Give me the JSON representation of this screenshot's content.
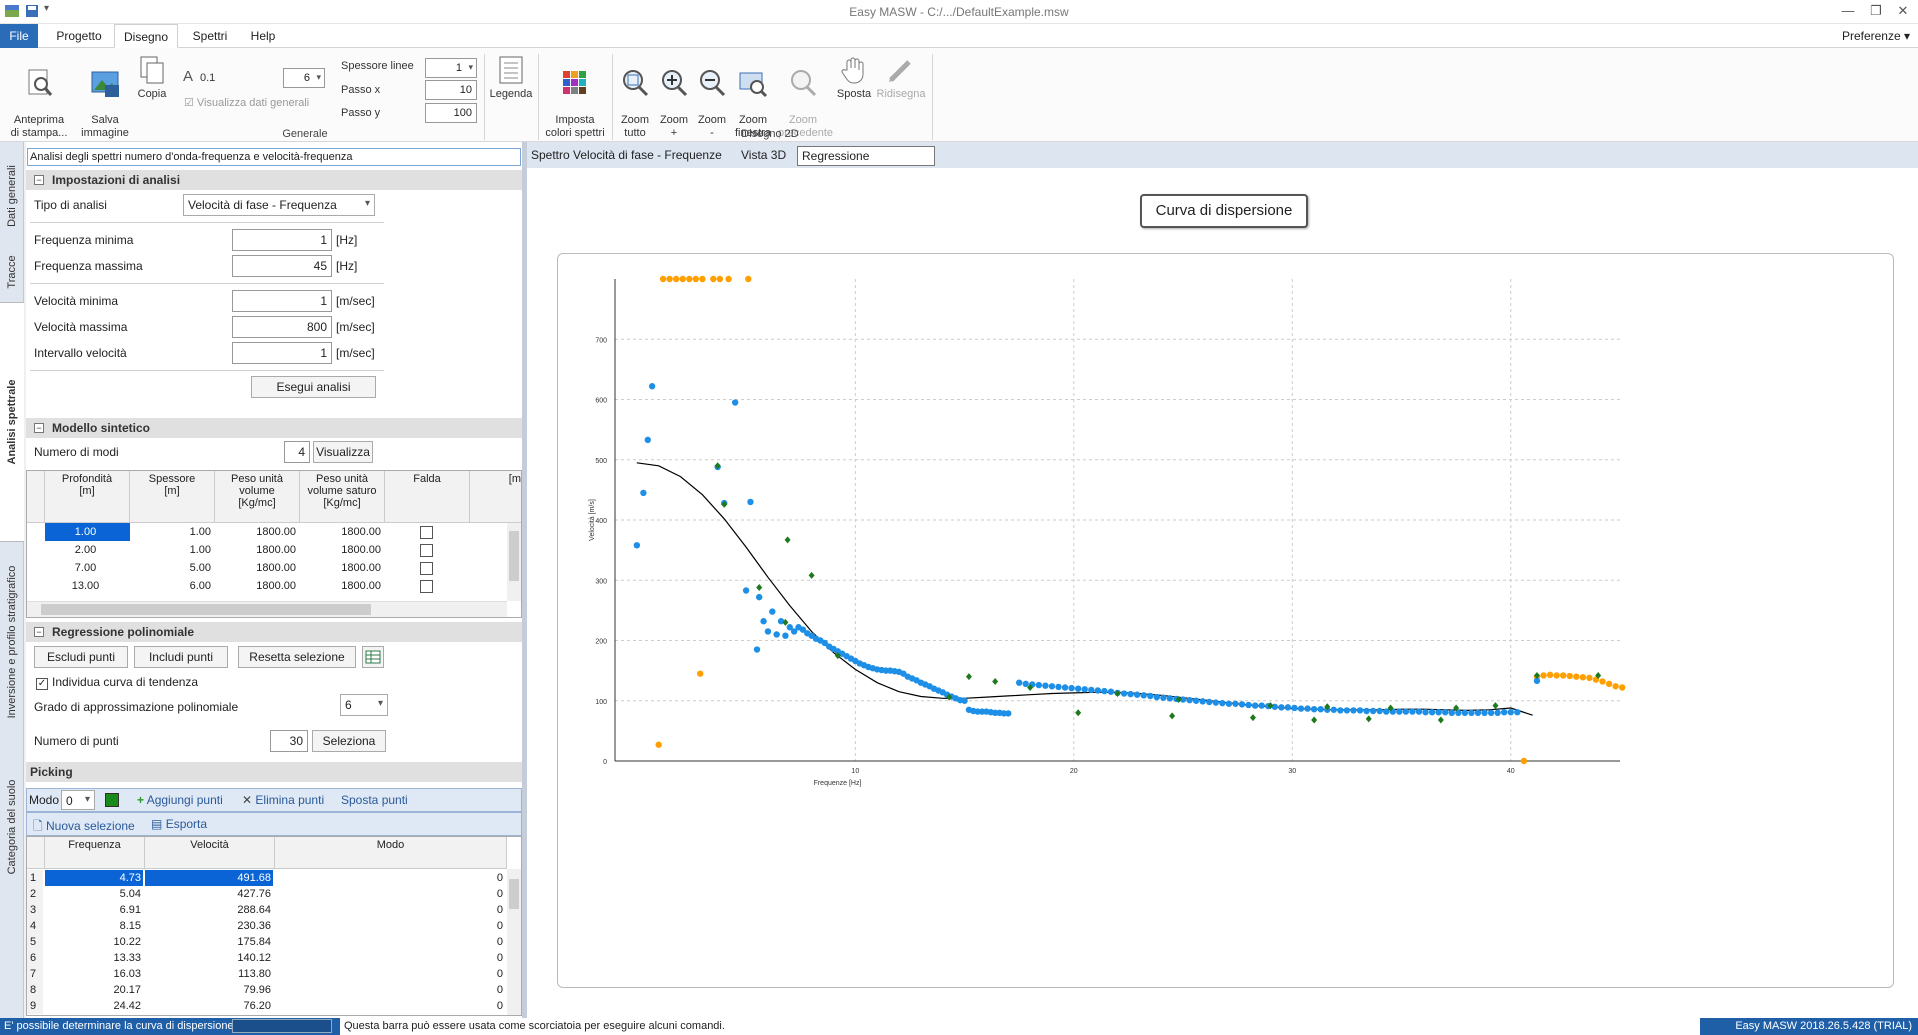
{
  "app": {
    "title": "Easy MASW - C:/.../DefaultExample.msw",
    "preferences": "Preferenze",
    "menu_tabs": [
      "File",
      "Progetto",
      "Disegno",
      "Spettri",
      "Help"
    ],
    "active_menu": "Disegno"
  },
  "ribbon": {
    "anteprima": "Anteprima\ndi stampa...",
    "salva": "Salva\nimmagine",
    "copia": "Copia",
    "font_label": "A",
    "font_size": "0.1",
    "size_value": "6",
    "visualizza": "Visualizza dati generali",
    "spessore_linee": "Spessore linee",
    "spessore_value": "1",
    "passo_x": "Passo x",
    "passo_x_value": "10",
    "passo_y": "Passo y",
    "passo_y_value": "100",
    "legenda": "Legenda",
    "imposta_colori": "Imposta\ncolori spettri",
    "group_generale": "Generale",
    "zoom_tutto": "Zoom\ntutto",
    "zoom_plus": "Zoom\n+",
    "zoom_minus": "Zoom\n-",
    "zoom_finestra": "Zoom\nfinestra",
    "zoom_precedente": "Zoom\nprecedente",
    "sposta": "Sposta",
    "ridisegna": "Ridisegna",
    "group_disegno": "Disegno 2D"
  },
  "vtabs": [
    "Dati generali",
    "Tracce",
    "Analisi spettrale",
    "Inversione e profilo stratigrafico",
    "Categoria del suolo"
  ],
  "left": {
    "description": "Analisi degli spettri numero d'onda-frequenza e velocità-frequenza",
    "sec_impostazioni": "Impostazioni di analisi",
    "tipo_analisi_label": "Tipo di analisi",
    "tipo_analisi_value": "Velocità di fase - Frequenza",
    "freq_min_label": "Frequenza minima",
    "freq_min": "1",
    "freq_max_label": "Frequenza massima",
    "freq_max": "45",
    "unit_hz": "[Hz]",
    "vel_min_label": "Velocità minima",
    "vel_min": "1",
    "vel_max_label": "Velocità massima",
    "vel_max": "800",
    "int_vel_label": "Intervallo velocità",
    "int_vel": "1",
    "unit_ms": "[m/sec]",
    "esegui": "Esegui analisi",
    "sec_modello": "Modello sintetico",
    "num_modi_label": "Numero di modi",
    "num_modi": "4",
    "visualizza_btn": "Visualizza",
    "model_headers": [
      "Profondità\n[m]",
      "Spessore\n[m]",
      "Peso unità\nvolume\n[Kg/mc]",
      "Peso unità\nvolume saturo\n[Kg/mc]",
      "Falda",
      "[m"
    ],
    "model_rows": [
      [
        "1.00",
        "1.00",
        "1800.00",
        "1800.00"
      ],
      [
        "2.00",
        "1.00",
        "1800.00",
        "1800.00"
      ],
      [
        "7.00",
        "5.00",
        "1800.00",
        "1800.00"
      ],
      [
        "13.00",
        "6.00",
        "1800.00",
        "1800.00"
      ]
    ],
    "sec_regressione": "Regressione polinomiale",
    "escludi": "Escludi punti",
    "includi": "Includi punti",
    "resetta": "Resetta selezione",
    "individua": "Individua curva di tendenza",
    "grado_label": "Grado di approssimazione polinomiale",
    "grado": "6",
    "num_punti_label": "Numero di punti",
    "num_punti": "30",
    "seleziona": "Seleziona",
    "sec_picking": "Picking",
    "modo_label": "Modo",
    "modo_value": "0",
    "aggiungi": "Aggiungi punti",
    "elimina": "Elimina punti",
    "sposta_punti": "Sposta punti",
    "nuova_sel": "Nuova selezione",
    "esporta": "Esporta",
    "pick_headers": [
      "Frequenza",
      "Velocità",
      "Modo"
    ],
    "pick_rows": [
      [
        "1",
        "4.73",
        "491.68",
        "0"
      ],
      [
        "2",
        "5.04",
        "427.76",
        "0"
      ],
      [
        "3",
        "6.91",
        "288.64",
        "0"
      ],
      [
        "4",
        "8.15",
        "230.36",
        "0"
      ],
      [
        "5",
        "10.22",
        "175.84",
        "0"
      ],
      [
        "6",
        "13.33",
        "140.12",
        "0"
      ],
      [
        "7",
        "16.03",
        "113.80",
        "0"
      ],
      [
        "8",
        "20.17",
        "79.96",
        "0"
      ],
      [
        "9",
        "24.42",
        "76.20",
        "0"
      ]
    ]
  },
  "right": {
    "tabs": [
      "Spettro Velocità di fase - Frequenze",
      "Vista 3D",
      "Regressione polinomiale"
    ],
    "active_tab": "Regressione polinomiale",
    "chart_title": "Curva di dispersione"
  },
  "chart_data": {
    "type": "scatter",
    "title": "Curva di dispersione",
    "xlabel": "Frequenze [Hz]",
    "ylabel": "Velocità [m/s]",
    "xlim": [
      0,
      45
    ],
    "ylim": [
      0,
      800
    ],
    "xticks": [
      10,
      20,
      30,
      40
    ],
    "yticks": [
      0,
      100,
      200,
      300,
      400,
      500,
      600,
      700
    ],
    "grid": true,
    "colors": {
      "blue": "#1e8fe6",
      "green": "#1f7a1f",
      "orange": "#ff9f00",
      "line": "#000000"
    },
    "series": [
      {
        "color_key": "orange",
        "marker": "circle",
        "points": [
          [
            1.2,
            800
          ],
          [
            1.5,
            800
          ],
          [
            1.8,
            800
          ],
          [
            2.1,
            800
          ],
          [
            2.4,
            800
          ],
          [
            2.7,
            800
          ],
          [
            3.0,
            800
          ],
          [
            3.5,
            800
          ],
          [
            3.8,
            800
          ],
          [
            4.2,
            800
          ],
          [
            5.1,
            800
          ],
          [
            2.9,
            145
          ],
          [
            1.0,
            27
          ],
          [
            40.6,
            0
          ],
          [
            41.2,
            140
          ],
          [
            41.5,
            142
          ],
          [
            41.8,
            143
          ],
          [
            42.1,
            142
          ],
          [
            42.4,
            142
          ],
          [
            42.7,
            141
          ],
          [
            43.0,
            140
          ],
          [
            43.3,
            139
          ],
          [
            43.6,
            138
          ],
          [
            43.9,
            135
          ],
          [
            44.2,
            132
          ],
          [
            44.5,
            128
          ],
          [
            44.8,
            124
          ],
          [
            45.1,
            122
          ]
        ]
      },
      {
        "color_key": "blue",
        "marker": "circle",
        "points": [
          [
            0,
            358
          ],
          [
            0.3,
            445
          ],
          [
            0.5,
            533
          ],
          [
            0.7,
            622
          ],
          [
            3.7,
            488
          ],
          [
            4.0,
            428
          ],
          [
            4.5,
            595
          ],
          [
            5.0,
            283
          ],
          [
            5.2,
            430
          ],
          [
            5.5,
            185
          ],
          [
            5.6,
            272
          ],
          [
            5.8,
            232
          ],
          [
            6.0,
            215
          ],
          [
            6.2,
            248
          ],
          [
            6.4,
            210
          ],
          [
            6.6,
            232
          ],
          [
            6.8,
            208
          ],
          [
            7.0,
            222
          ],
          [
            7.2,
            215
          ],
          [
            7.4,
            222
          ],
          [
            7.6,
            218
          ],
          [
            7.8,
            212
          ],
          [
            8.0,
            208
          ],
          [
            8.2,
            203
          ],
          [
            8.4,
            200
          ],
          [
            8.6,
            196
          ],
          [
            8.8,
            190
          ],
          [
            9.0,
            186
          ],
          [
            9.2,
            182
          ],
          [
            9.4,
            178
          ],
          [
            9.6,
            174
          ],
          [
            9.8,
            170
          ],
          [
            10.0,
            166
          ],
          [
            10.2,
            162
          ],
          [
            10.4,
            159
          ],
          [
            10.6,
            156
          ],
          [
            10.8,
            154
          ],
          [
            11.0,
            152
          ],
          [
            11.2,
            151
          ],
          [
            11.4,
            150
          ],
          [
            11.6,
            150
          ],
          [
            11.8,
            149
          ],
          [
            12.0,
            148
          ],
          [
            12.2,
            145
          ],
          [
            12.4,
            140
          ],
          [
            12.6,
            137
          ],
          [
            12.8,
            134
          ],
          [
            13.0,
            130
          ],
          [
            13.2,
            127
          ],
          [
            13.4,
            124
          ],
          [
            13.6,
            120
          ],
          [
            13.8,
            117
          ],
          [
            14.0,
            114
          ],
          [
            14.2,
            110
          ],
          [
            14.4,
            107
          ],
          [
            14.6,
            104
          ],
          [
            14.8,
            101
          ],
          [
            15.0,
            100
          ],
          [
            15.2,
            85
          ],
          [
            15.4,
            83
          ],
          [
            15.6,
            82
          ],
          [
            15.8,
            82
          ],
          [
            16.0,
            82
          ],
          [
            16.2,
            81
          ],
          [
            16.4,
            80
          ],
          [
            16.6,
            80
          ],
          [
            16.8,
            79
          ],
          [
            17.0,
            79
          ],
          [
            17.5,
            130
          ],
          [
            17.8,
            128
          ],
          [
            18.1,
            127
          ],
          [
            18.4,
            126
          ],
          [
            18.7,
            125
          ],
          [
            19.0,
            124
          ],
          [
            19.3,
            123
          ],
          [
            19.6,
            122
          ],
          [
            19.9,
            121
          ],
          [
            20.2,
            120
          ],
          [
            20.5,
            119
          ],
          [
            20.8,
            118
          ],
          [
            21.1,
            117
          ],
          [
            21.4,
            116
          ],
          [
            21.7,
            115
          ],
          [
            22.0,
            113
          ],
          [
            22.3,
            112
          ],
          [
            22.6,
            111
          ],
          [
            22.9,
            110
          ],
          [
            23.2,
            109
          ],
          [
            23.5,
            108
          ],
          [
            23.8,
            106
          ],
          [
            24.1,
            105
          ],
          [
            24.4,
            104
          ],
          [
            24.7,
            103
          ],
          [
            25.0,
            102
          ],
          [
            25.3,
            101
          ],
          [
            25.6,
            100
          ],
          [
            25.9,
            99
          ],
          [
            26.2,
            98
          ],
          [
            26.5,
            97
          ],
          [
            26.8,
            96
          ],
          [
            27.1,
            95
          ],
          [
            27.4,
            95
          ],
          [
            27.7,
            94
          ],
          [
            28.0,
            93
          ],
          [
            28.3,
            92
          ],
          [
            28.6,
            92
          ],
          [
            28.9,
            91
          ],
          [
            29.2,
            90
          ],
          [
            29.5,
            89
          ],
          [
            29.8,
            89
          ],
          [
            30.1,
            88
          ],
          [
            30.4,
            87
          ],
          [
            30.7,
            87
          ],
          [
            31.0,
            86
          ],
          [
            31.3,
            86
          ],
          [
            31.6,
            85
          ],
          [
            31.9,
            85
          ],
          [
            32.2,
            84
          ],
          [
            32.5,
            84
          ],
          [
            32.8,
            84
          ],
          [
            33.1,
            84
          ],
          [
            33.4,
            83
          ],
          [
            33.7,
            83
          ],
          [
            34.0,
            83
          ],
          [
            34.3,
            82
          ],
          [
            34.6,
            82
          ],
          [
            34.9,
            82
          ],
          [
            35.2,
            82
          ],
          [
            35.5,
            82
          ],
          [
            35.8,
            82
          ],
          [
            36.1,
            81
          ],
          [
            36.4,
            81
          ],
          [
            36.7,
            81
          ],
          [
            37.0,
            81
          ],
          [
            37.3,
            80
          ],
          [
            37.6,
            80
          ],
          [
            37.9,
            80
          ],
          [
            38.2,
            80
          ],
          [
            38.5,
            80
          ],
          [
            38.8,
            80
          ],
          [
            39.1,
            80
          ],
          [
            39.4,
            80
          ],
          [
            39.7,
            81
          ],
          [
            40.0,
            81
          ],
          [
            40.3,
            81
          ],
          [
            41.2,
            133
          ]
        ]
      },
      {
        "color_key": "green",
        "marker": "diamond",
        "points": [
          [
            3.7,
            490
          ],
          [
            4.0,
            426
          ],
          [
            5.6,
            288
          ],
          [
            6.8,
            230
          ],
          [
            6.9,
            367
          ],
          [
            8.0,
            308
          ],
          [
            9.2,
            175
          ],
          [
            14.3,
            106
          ],
          [
            15.2,
            140
          ],
          [
            16.4,
            132
          ],
          [
            18.0,
            122
          ],
          [
            20.2,
            80
          ],
          [
            22.0,
            112
          ],
          [
            24.5,
            75
          ],
          [
            24.8,
            102
          ],
          [
            28.2,
            72
          ],
          [
            29.0,
            92
          ],
          [
            31.0,
            68
          ],
          [
            31.6,
            90
          ],
          [
            33.5,
            70
          ],
          [
            34.5,
            88
          ],
          [
            36.8,
            68
          ],
          [
            37.5,
            88
          ],
          [
            39.3,
            92
          ],
          [
            41.2,
            142
          ],
          [
            44.0,
            142
          ]
        ]
      }
    ],
    "trend_line": {
      "color_key": "line",
      "points": [
        [
          0,
          495
        ],
        [
          1,
          490
        ],
        [
          2,
          472
        ],
        [
          3,
          442
        ],
        [
          4,
          402
        ],
        [
          5,
          355
        ],
        [
          6,
          305
        ],
        [
          7,
          258
        ],
        [
          8,
          215
        ],
        [
          9,
          180
        ],
        [
          10,
          152
        ],
        [
          11,
          130
        ],
        [
          12,
          115
        ],
        [
          13,
          107
        ],
        [
          14,
          104
        ],
        [
          15,
          104
        ],
        [
          16,
          106
        ],
        [
          17,
          108
        ],
        [
          18,
          110
        ],
        [
          19,
          112
        ],
        [
          20,
          113
        ],
        [
          21,
          114
        ],
        [
          22,
          114
        ],
        [
          23,
          112
        ],
        [
          24,
          109
        ],
        [
          25,
          105
        ],
        [
          26,
          101
        ],
        [
          27,
          97
        ],
        [
          28,
          93
        ],
        [
          29,
          90
        ],
        [
          30,
          87
        ],
        [
          31,
          86
        ],
        [
          32,
          85
        ],
        [
          33,
          85
        ],
        [
          34,
          85
        ],
        [
          35,
          86
        ],
        [
          36,
          86
        ],
        [
          37,
          85
        ],
        [
          38,
          84
        ],
        [
          39,
          85
        ],
        [
          40,
          88
        ],
        [
          41,
          76
        ]
      ]
    }
  },
  "status": {
    "left": "E' possibile determinare la curva di dispersione.",
    "hint": "Questa barra può essere usata come scorciatoia per eseguire alcuni comandi.",
    "version": "Easy MASW 2018.26.5.428 (TRIAL)"
  }
}
